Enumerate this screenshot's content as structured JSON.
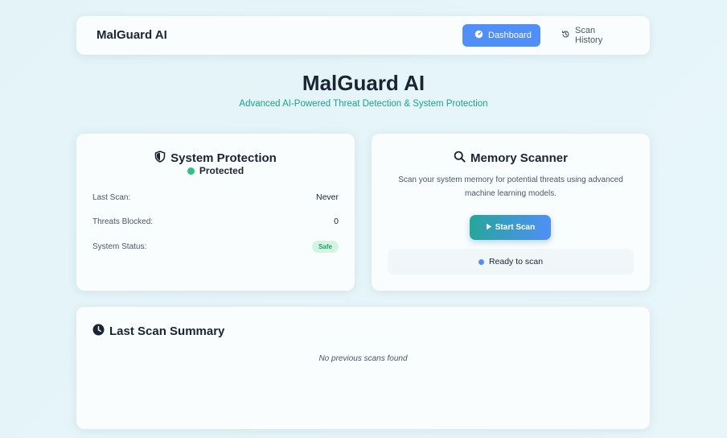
{
  "navbar": {
    "brand": "MalGuard AI",
    "dashboard_label": "Dashboard",
    "history_label": "Scan History"
  },
  "hero": {
    "title": "MalGuard AI",
    "subtitle": "Advanced AI-Powered Threat Detection & System Protection"
  },
  "protection": {
    "title": "System Protection",
    "status": "Protected",
    "rows": [
      {
        "label": "Last Scan:",
        "value": "Never"
      },
      {
        "label": "Threats Blocked:",
        "value": "0"
      },
      {
        "label": "System Status:",
        "value": "Safe"
      }
    ]
  },
  "scanner": {
    "title": "Memory Scanner",
    "description": "Scan your system memory for potential threats using advanced machine learning models.",
    "start_label": "Start Scan",
    "ready_text": "Ready to scan"
  },
  "summary": {
    "title": "Last Scan Summary",
    "empty_text": "No previous scans found"
  },
  "colors": {
    "accent_blue": "#4f8ff7",
    "teal": "#1aa18f",
    "safe_green": "#21a264",
    "protected_dot": "#2ec27e"
  },
  "icons": {
    "dashboard": "gauge-icon",
    "history": "history-icon",
    "protection": "shield-icon",
    "scanner": "magnifier-icon",
    "start": "play-icon",
    "summary": "clock-icon"
  }
}
